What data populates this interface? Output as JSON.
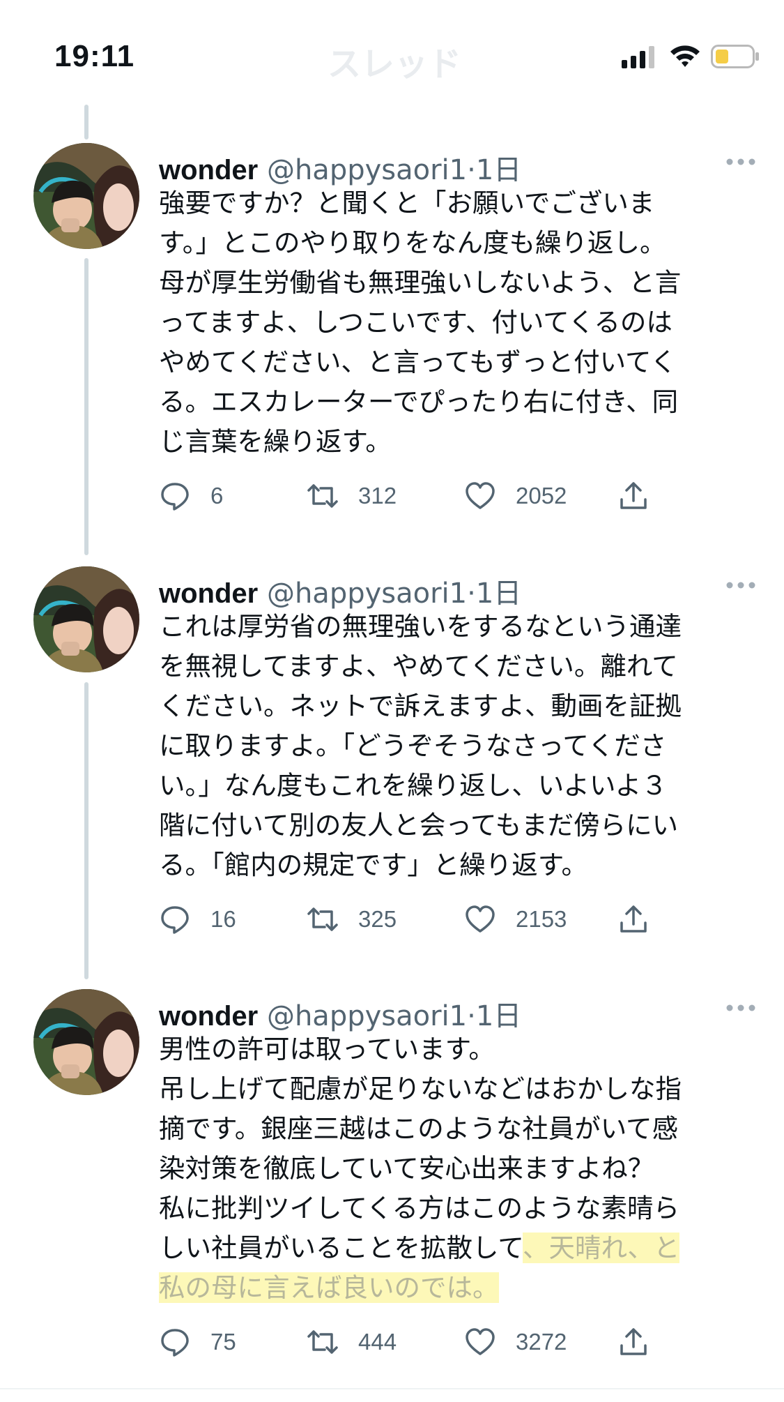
{
  "status_bar": {
    "time": "19:11",
    "title_ghost": "スレッド"
  },
  "tweets": [
    {
      "author": {
        "name": "wonder",
        "handle": "@happysaori1",
        "separator": "·",
        "time": "1日"
      },
      "lines": [
        "強要ですか？と聞くと「お願いでございま",
        "す。」とこのやり取りをなん度も繰り返し。",
        "母が厚生労働省も無理強いしないよう、と言",
        "ってますよ、しつこいです、付いてくるのは",
        "やめてください、と言ってもずっと付いてく",
        "る。エスカレーターでぴったり右に付き、同",
        "じ言葉を繰り返す。"
      ],
      "stats": {
        "replies": "6",
        "retweets": "312",
        "likes": "2052"
      }
    },
    {
      "author": {
        "name": "wonder",
        "handle": "@happysaori1",
        "separator": "·",
        "time": "1日"
      },
      "lines": [
        "これは厚労省の無理強いをするなという通達",
        "を無視してますよ、やめてください。離れて",
        "ください。ネットで訴えますよ、動画を証拠",
        "に取りますよ。「どうぞそうなさってくださ",
        "い。」なん度もこれを繰り返し、いよいよ３",
        "階に付いて別の友人と会ってもまだ傍らにい",
        "る。「館内の規定です」と繰り返す。"
      ],
      "stats": {
        "replies": "16",
        "retweets": "325",
        "likes": "2153"
      }
    },
    {
      "author": {
        "name": "wonder",
        "handle": "@happysaori1",
        "separator": "·",
        "time": "1日"
      },
      "lines": [
        "男性の許可は取っています。",
        "吊し上げて配慮が足りないなどはおかしな指",
        "摘です。銀座三越はこのような社員がいて感",
        "染対策を徹底していて安心出来ますよね？",
        "私に批判ツイしてくる方はこのような素晴ら",
        "しい社員がいることを拡散して",
        "私の母に言えば良いのでは。"
      ],
      "highlight_tail": "、天晴れ、と",
      "stats": {
        "replies": "75",
        "retweets": "444",
        "likes": "3272"
      }
    }
  ],
  "colors": {
    "text": "#0f1419",
    "secondary": "#536471",
    "thread_line": "#cfd9de",
    "highlight": "#fdf8b8",
    "battery_fill": "#f5cd47"
  },
  "icons": [
    "reply-icon",
    "retweet-icon",
    "like-icon",
    "share-icon",
    "more-icon",
    "signal-icon",
    "wifi-icon",
    "battery-icon"
  ]
}
